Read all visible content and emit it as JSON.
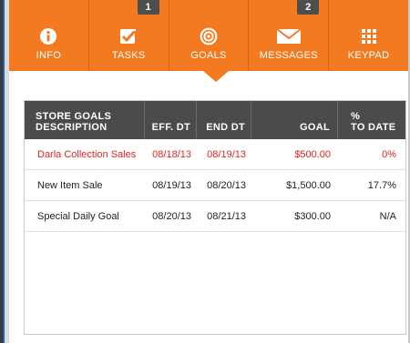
{
  "nav": {
    "tabs": [
      {
        "label": "INFO",
        "icon": "info-icon",
        "badge": ""
      },
      {
        "label": "TASKS",
        "icon": "checkbox-icon",
        "badge": "1"
      },
      {
        "label": "GOALS",
        "icon": "target-icon",
        "badge": "",
        "active": true
      },
      {
        "label": "MESSAGES",
        "icon": "envelope-icon",
        "badge": "2"
      },
      {
        "label": "KEYPAD",
        "icon": "keypad-icon",
        "badge": ""
      }
    ],
    "accent_color": "#f47a21",
    "badge_color": "#4e4e4e"
  },
  "table": {
    "headers": {
      "description_line1": "STORE GOALS",
      "description_line2": "DESCRIPTION",
      "eff_dt": "EFF. DT",
      "end_dt": "END DT",
      "goal": "GOAL",
      "to_date_line1": "%",
      "to_date_line2": "TO DATE"
    },
    "header_color": "#4b4b4b",
    "alert_color": "#e5241d",
    "rows": [
      {
        "description": "Darla Collection Sales",
        "eff_dt": "08/18/13",
        "end_dt": "08/19/13",
        "goal": "$500.00",
        "to_date": "0%",
        "alert": true
      },
      {
        "description": "New Item Sale",
        "eff_dt": "08/19/13",
        "end_dt": "08/20/13",
        "goal": "$1,500.00",
        "to_date": "17.7%",
        "alert": false
      },
      {
        "description": "Special Daily Goal",
        "eff_dt": "08/20/13",
        "end_dt": "08/21/13",
        "goal": "$300.00",
        "to_date": "N/A",
        "alert": false
      }
    ]
  }
}
